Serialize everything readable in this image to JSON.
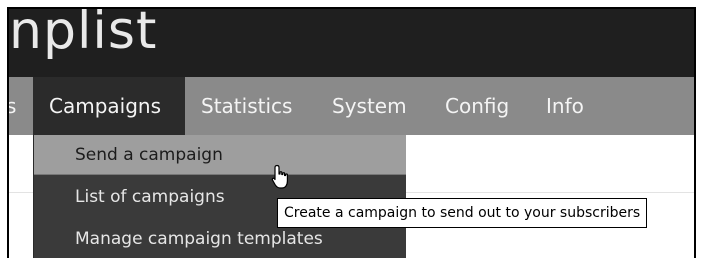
{
  "header": {
    "logo_text": "nplist"
  },
  "nav": {
    "items": [
      {
        "label": "s"
      },
      {
        "label": "Campaigns"
      },
      {
        "label": "Statistics"
      },
      {
        "label": "System"
      },
      {
        "label": "Config"
      },
      {
        "label": "Info"
      }
    ]
  },
  "dropdown": {
    "items": [
      {
        "label": "Send a campaign"
      },
      {
        "label": "List of campaigns"
      },
      {
        "label": "Manage campaign templates"
      }
    ]
  },
  "tooltip": {
    "text": "Create a campaign to send out to your subscribers"
  },
  "cursor": {
    "icon": "hand-pointer-icon"
  },
  "colors": {
    "header_bg": "#1f1f1f",
    "nav_bg": "#8a8a8a",
    "active_nav_bg": "#2b2b2b",
    "dropdown_bg": "#3a3a3a",
    "hover_item_bg": "#9e9e9e"
  }
}
